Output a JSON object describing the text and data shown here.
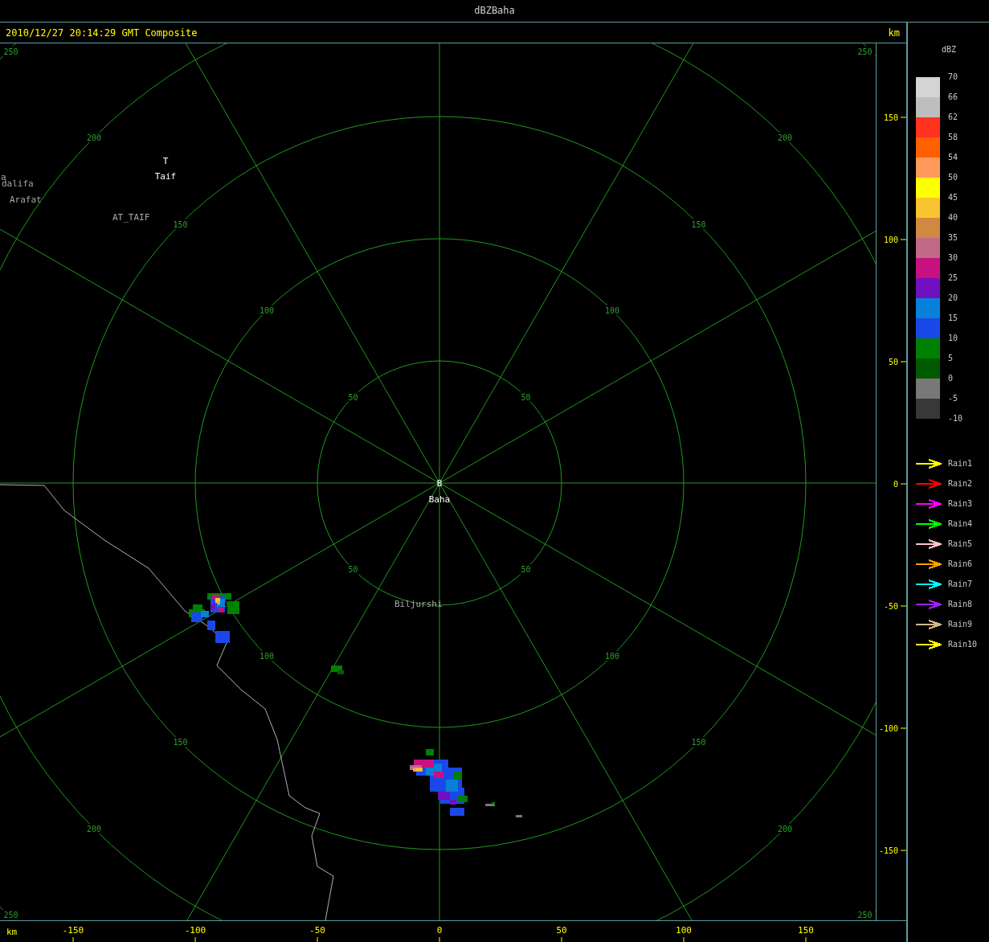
{
  "window": {
    "title": "dBZBaha"
  },
  "header": {
    "timestamp": "2010/12/27 20:14:29 GMT Composite",
    "unit": "km"
  },
  "map": {
    "range_rings": [
      {
        "labels": [
          "50",
          "50",
          "50",
          "50"
        ]
      },
      {
        "labels": [
          "100",
          "100",
          "100",
          "100"
        ]
      },
      {
        "labels": [
          "150",
          "150",
          "150",
          "150"
        ]
      },
      {
        "labels": [
          "200",
          "200",
          "200",
          "200"
        ]
      },
      {
        "labels": [
          "250",
          "250",
          "250",
          "250"
        ]
      }
    ],
    "places": [
      {
        "kind": "site",
        "marker": "B",
        "name": "Baha"
      },
      {
        "kind": "site",
        "marker": "T",
        "name": "Taif"
      },
      {
        "kind": "town",
        "name": "a"
      },
      {
        "kind": "town",
        "name": "dalifa"
      },
      {
        "kind": "town",
        "name": "Arafat"
      },
      {
        "kind": "town",
        "name": "AT_TAIF"
      },
      {
        "kind": "town",
        "name": "Biljurshi"
      }
    ]
  },
  "y_axis": {
    "ticks": [
      "150",
      "100",
      "50",
      "0",
      "-50",
      "-100",
      "-150"
    ]
  },
  "x_axis": {
    "unit": "km",
    "ticks": [
      "-150",
      "-100",
      "-50",
      "0",
      "50",
      "100",
      "150"
    ]
  },
  "legend": {
    "title": "dBZ",
    "scale": [
      {
        "label": "70",
        "color": "#d4d4d4"
      },
      {
        "label": "66",
        "color": "#bebebe"
      },
      {
        "label": "62",
        "color": "#ff3320"
      },
      {
        "label": "58",
        "color": "#ff6000"
      },
      {
        "label": "54",
        "color": "#ff9a5a"
      },
      {
        "label": "50",
        "color": "#ffff00"
      },
      {
        "label": "45",
        "color": "#f8c430"
      },
      {
        "label": "40",
        "color": "#d08a40"
      },
      {
        "label": "35",
        "color": "#c06888"
      },
      {
        "label": "30",
        "color": "#c81080"
      },
      {
        "label": "25",
        "color": "#7010c0"
      },
      {
        "label": "20",
        "color": "#0880d8"
      },
      {
        "label": "15",
        "color": "#1a48e8"
      },
      {
        "label": "10",
        "color": "#008000"
      },
      {
        "label": "5",
        "color": "#005a00"
      },
      {
        "label": "0",
        "color": "#787878"
      },
      {
        "label": "-5",
        "color": "#383838"
      },
      {
        "label": "-10"
      }
    ],
    "tracks": [
      {
        "name": "Rain1",
        "color": "#ffff00"
      },
      {
        "name": "Rain2",
        "color": "#ff0000"
      },
      {
        "name": "Rain3",
        "color": "#ff00ff"
      },
      {
        "name": "Rain4",
        "color": "#00ff00"
      },
      {
        "name": "Rain5",
        "color": "#ffc0cb"
      },
      {
        "name": "Rain6",
        "color": "#ffa000"
      },
      {
        "name": "Rain7",
        "color": "#00ffff"
      },
      {
        "name": "Rain8",
        "color": "#a020f0"
      },
      {
        "name": "Rain9",
        "color": "#d2b48c"
      },
      {
        "name": "Rain10",
        "color": "#ffff00"
      }
    ]
  }
}
